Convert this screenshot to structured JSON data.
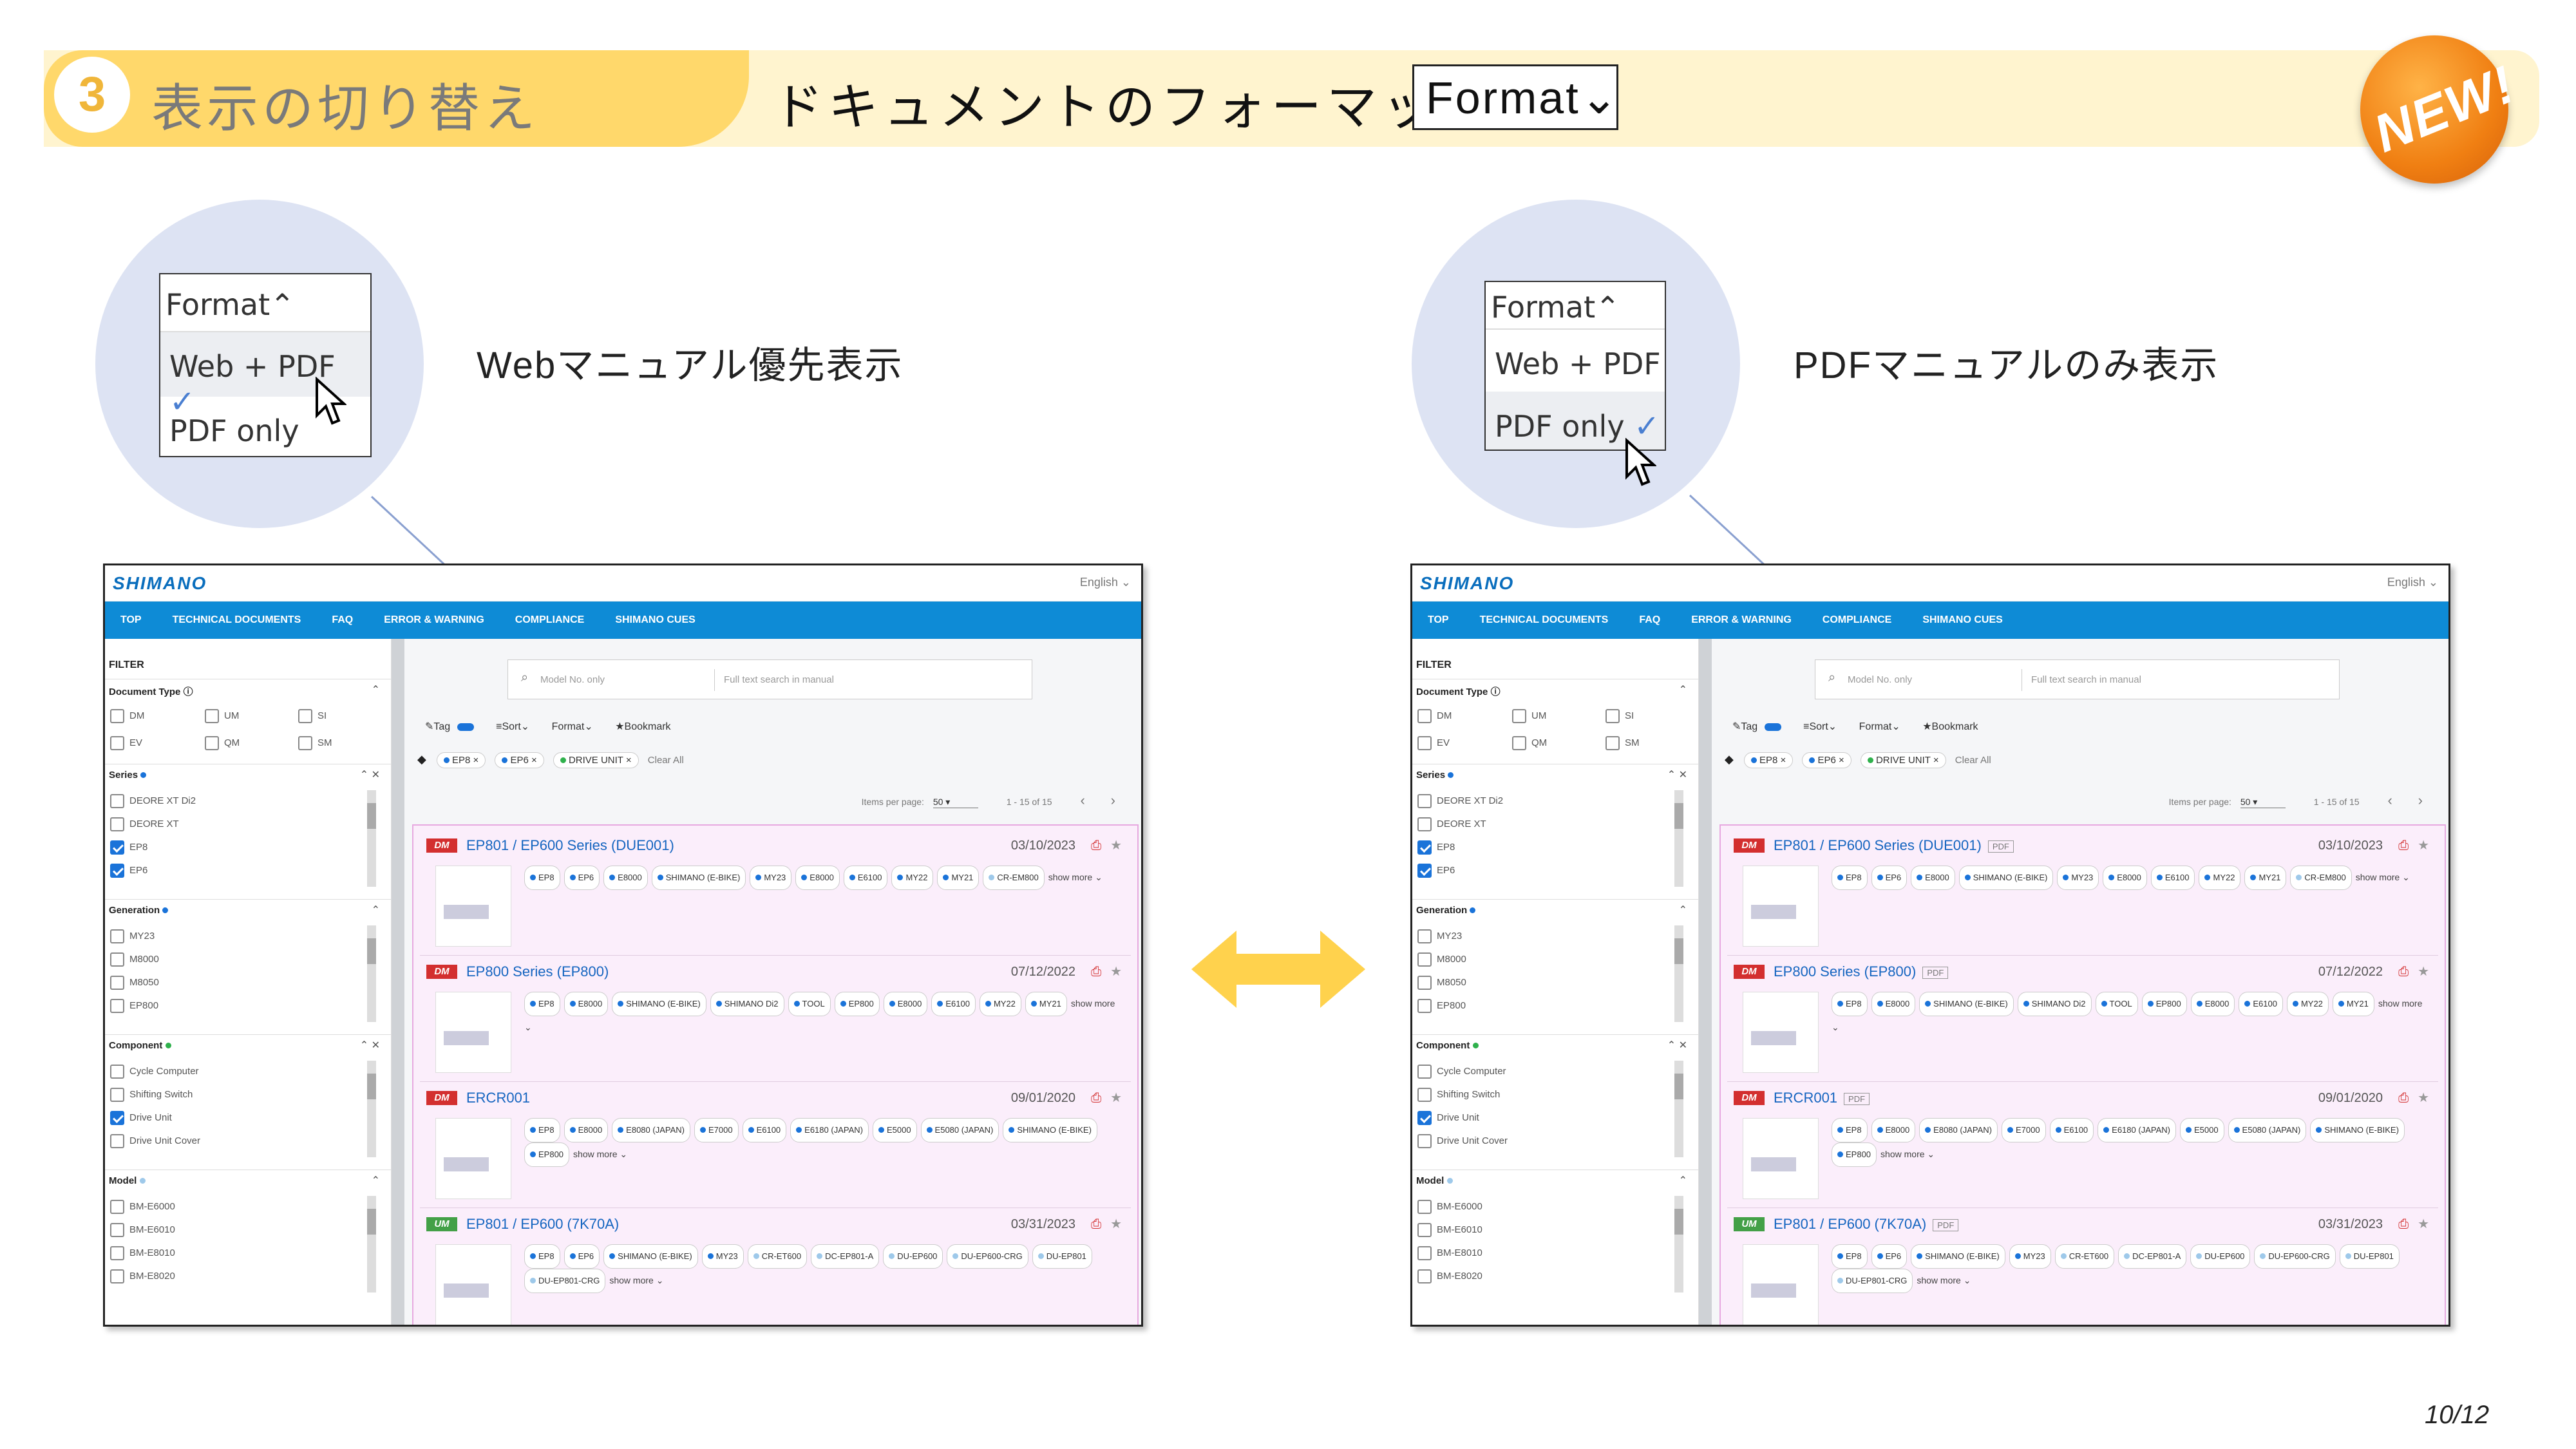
{
  "header": {
    "step_number": "3",
    "step_title": "表示の切り替え",
    "subtitle": "ドキュメントのフォーマット",
    "format_button": "Format⌄",
    "new_badge": "NEW!"
  },
  "left_zoom": {
    "menu_title": "Format⌃",
    "option1": "Web + PDF",
    "option1_check": "✓",
    "option2": "PDF only",
    "description": "Webマニュアル優先表示"
  },
  "right_zoom": {
    "menu_title": "Format⌃",
    "option1": "Web + PDF",
    "option2": "PDF only",
    "option2_check": "✓",
    "description": "PDFマニュアルのみ表示"
  },
  "page_number": "10/12",
  "site": {
    "logo": "SHIMANO",
    "language": "English ⌄",
    "nav": [
      "TOP",
      "TECHNICAL DOCUMENTS",
      "FAQ",
      "ERROR & WARNING",
      "COMPLIANCE",
      "SHIMANO CUES"
    ],
    "filter_label": "FILTER",
    "doc_type_label": "Document Type ⓘ",
    "doc_types": [
      "DM",
      "UM",
      "SI",
      "EV",
      "QM",
      "SM"
    ],
    "series_label": "Series",
    "series": [
      "DEORE XT Di2",
      "DEORE XT",
      "EP8",
      "EP6"
    ],
    "generation_label": "Generation",
    "generation": [
      "MY23",
      "M8000",
      "M8050",
      "EP800"
    ],
    "component_label": "Component",
    "component": [
      "Cycle Computer",
      "Shifting Switch",
      "Drive Unit",
      "Drive Unit Cover"
    ],
    "model_label": "Model",
    "model": [
      "BM-E6000",
      "BM-E6010",
      "BM-E8010",
      "BM-E8020"
    ],
    "search_model_placeholder": "Model No. only",
    "search_full_placeholder": "Full text search in manual",
    "tool_tag": "Tag",
    "tool_sort": "Sort⌄",
    "tool_format": "Format⌄",
    "tool_bookmark": "★Bookmark",
    "active_tags": [
      "EP8",
      "EP6",
      "DRIVE UNIT"
    ],
    "clear_all": "Clear All",
    "items_per_page_label": "Items per page:",
    "items_per_page": "50",
    "range": "1 - 15 of 15",
    "results": [
      {
        "badge": "DM",
        "title": "EP801 / EP600 Series (DUE001)",
        "date": "03/10/2023",
        "tags": [
          "EP8",
          "EP6",
          "E8000",
          "SHIMANO (E-BIKE)",
          "MY23",
          "E8000",
          "E6100",
          "MY22",
          "MY21",
          "CR-EM800"
        ],
        "more": "show more ⌄"
      },
      {
        "badge": "DM",
        "title": "EP800 Series (EP800)",
        "date": "07/12/2022",
        "tags": [
          "EP8",
          "E8000",
          "SHIMANO (E-BIKE)",
          "SHIMANO Di2",
          "TOOL",
          "EP800",
          "E8000",
          "E6100",
          "MY22",
          "MY21"
        ],
        "more": "show more ⌄"
      },
      {
        "badge": "DM",
        "title": "ERCR001",
        "date": "09/01/2020",
        "tags": [
          "EP8",
          "E8000",
          "E8080 (JAPAN)",
          "E7000",
          "E6100",
          "E6180 (JAPAN)",
          "E5000",
          "E5080 (JAPAN)",
          "SHIMANO (E-BIKE)",
          "EP800"
        ],
        "more": "show more ⌄"
      },
      {
        "badge": "UM",
        "title": "EP801 / EP600 (7K70A)",
        "date": "03/31/2023",
        "tags": [
          "EP8",
          "EP6",
          "SHIMANO (E-BIKE)",
          "MY23",
          "CR-ET600",
          "DC-EP801-A",
          "DU-EP600",
          "DU-EP600-CRG",
          "DU-EP801",
          "DU-EP801-CRG"
        ],
        "more": "show more ⌄"
      }
    ],
    "pdf_badge": "PDF"
  },
  "colors": {
    "accent": "#0e8bd6",
    "header_yellow": "#ffd86b",
    "arrow": "#ffd24d"
  }
}
